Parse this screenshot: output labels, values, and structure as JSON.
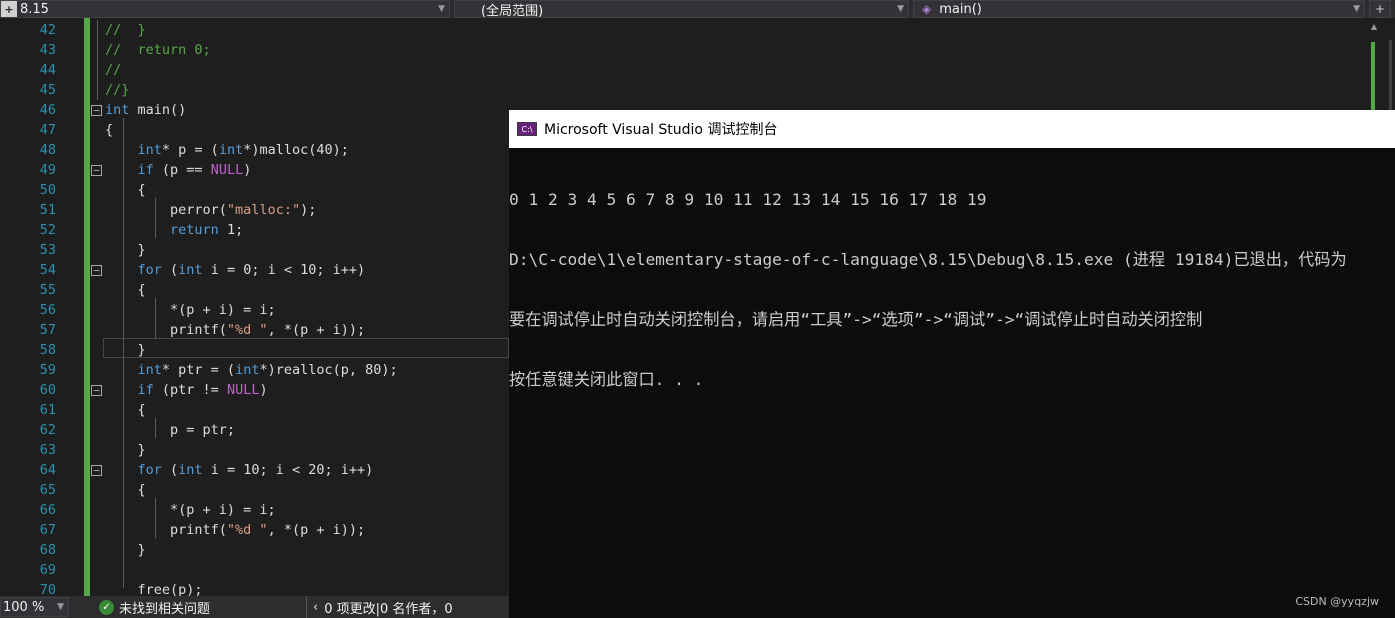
{
  "navbar": {
    "file": "8.15",
    "scope": "(全局范围)",
    "function": "main()"
  },
  "editor": {
    "lines": [
      {
        "n": "42",
        "code": "//  }"
      },
      {
        "n": "43",
        "code": "//  return 0;"
      },
      {
        "n": "44",
        "code": "//"
      },
      {
        "n": "45",
        "code": "//}"
      },
      {
        "n": "46",
        "code": "int main()"
      },
      {
        "n": "47",
        "code": "{"
      },
      {
        "n": "48",
        "code": "    int* p = (int*)malloc(40);"
      },
      {
        "n": "49",
        "code": "    if (p == NULL)"
      },
      {
        "n": "50",
        "code": "    {"
      },
      {
        "n": "51",
        "code": "        perror(\"malloc:\");"
      },
      {
        "n": "52",
        "code": "        return 1;"
      },
      {
        "n": "53",
        "code": "    }"
      },
      {
        "n": "54",
        "code": "    for (int i = 0; i < 10; i++)"
      },
      {
        "n": "55",
        "code": "    {"
      },
      {
        "n": "56",
        "code": "        *(p + i) = i;"
      },
      {
        "n": "57",
        "code": "        printf(\"%d \", *(p + i));"
      },
      {
        "n": "58",
        "code": "    }"
      },
      {
        "n": "59",
        "code": "    int* ptr = (int*)realloc(p, 80);"
      },
      {
        "n": "60",
        "code": "    if (ptr != NULL)"
      },
      {
        "n": "61",
        "code": "    {"
      },
      {
        "n": "62",
        "code": "        p = ptr;"
      },
      {
        "n": "63",
        "code": "    }"
      },
      {
        "n": "64",
        "code": "    for (int i = 10; i < 20; i++)"
      },
      {
        "n": "65",
        "code": "    {"
      },
      {
        "n": "66",
        "code": "        *(p + i) = i;"
      },
      {
        "n": "67",
        "code": "        printf(\"%d \", *(p + i));"
      },
      {
        "n": "68",
        "code": "    }"
      },
      {
        "n": "69",
        "code": ""
      },
      {
        "n": "70",
        "code": "    free(p);"
      }
    ]
  },
  "console": {
    "title": "Microsoft Visual Studio 调试控制台",
    "icon_text": "C:\\",
    "lines": [
      "0 1 2 3 4 5 6 7 8 9 10 11 12 13 14 15 16 17 18 19",
      "D:\\C-code\\1\\elementary-stage-of-c-language\\8.15\\Debug\\8.15.exe (进程 19184)已退出，代码为",
      "要在调试停止时自动关闭控制台，请启用“工具”->“选项”->“调试”->“调试停止时自动关闭控制",
      "按任意键关闭此窗口. . ."
    ],
    "watermark": "CSDN @yyqzjw"
  },
  "statusbar": {
    "zoom": "100 %",
    "issues": "未找到相关问题",
    "changes": "0 项更改|0 名作者，0"
  },
  "colors": {
    "keyword": "#569cd6",
    "comment": "#57a64a",
    "string": "#d69d85",
    "line_number": "#2b91af",
    "console_icon": "#68217a"
  }
}
